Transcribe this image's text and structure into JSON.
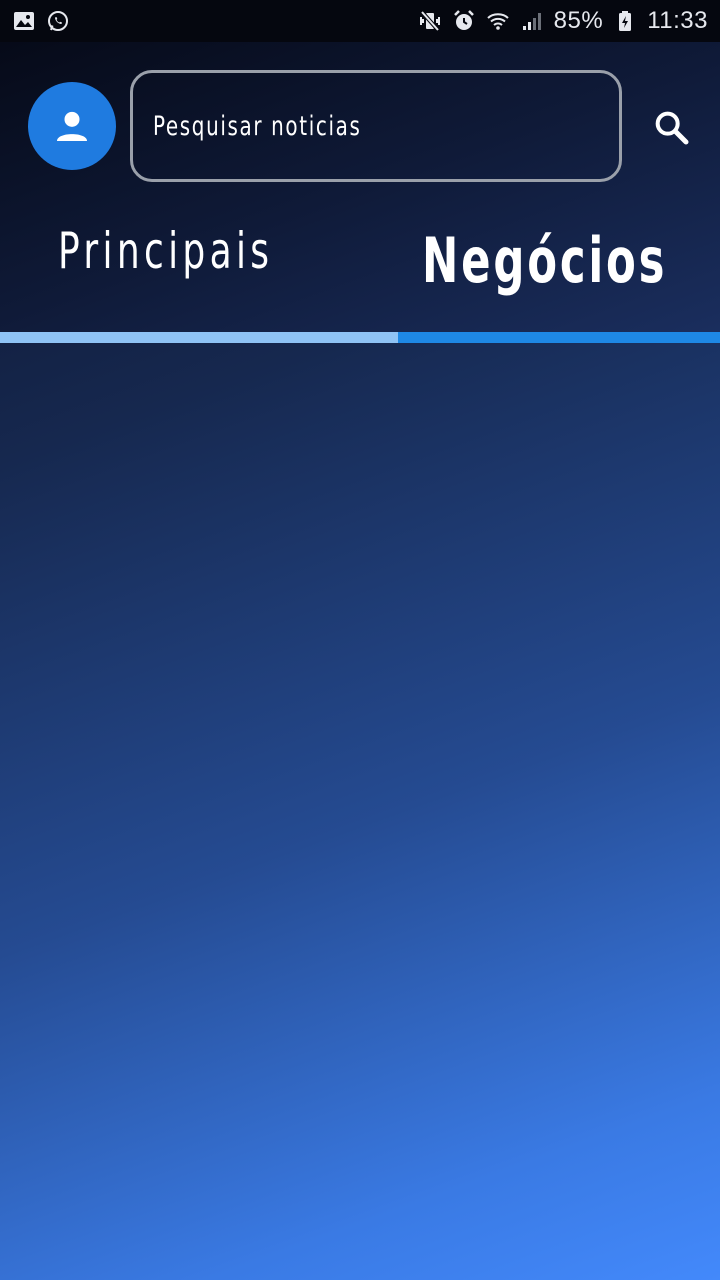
{
  "status_bar": {
    "left_icons": [
      "image-icon",
      "whatsapp-icon"
    ],
    "right_icons": [
      "mute-vibrate-icon",
      "alarm-icon",
      "wifi-icon",
      "signal-icon"
    ],
    "battery_percent": "85%",
    "time": "11:33"
  },
  "header": {
    "search": {
      "placeholder": "Pesquisar noticias"
    },
    "tabs": [
      {
        "label": "Principais",
        "selected": false
      },
      {
        "label": "Negócios",
        "selected": true
      }
    ]
  },
  "colors": {
    "avatar_bg": "#1f7be0",
    "tab_indicator_left": "#8fc3f5",
    "tab_indicator_right": "#1e88e5",
    "gradient_start": "#0b1026",
    "gradient_end": "#4389fb"
  }
}
